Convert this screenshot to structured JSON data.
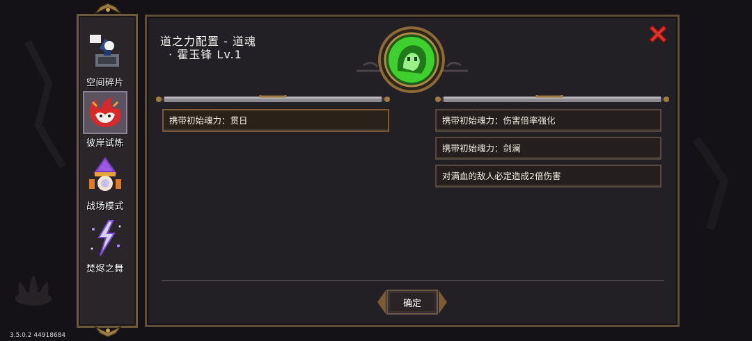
{
  "sidebar": {
    "items": [
      {
        "label": "空间碎片",
        "icon": "space-fragment-icon"
      },
      {
        "label": "彼岸试炼",
        "icon": "fox-spirit-icon",
        "active": true
      },
      {
        "label": "战场模式",
        "icon": "wizard-orb-icon"
      },
      {
        "label": "焚烬之舞",
        "icon": "lightning-rune-icon"
      }
    ]
  },
  "dialog": {
    "title": "道之力配置 - 道魂\n  · 霍玉锋 Lv.1",
    "emblem_icon": "green-soul-emblem-icon",
    "close_icon": "close-icon",
    "left_slots": [
      "携带初始魂力：贯日"
    ],
    "right_slots": [
      "携带初始魂力：伤害倍率强化",
      "携带初始魂力：剑澜",
      "对满血的敌人必定造成2倍伤害"
    ],
    "confirm_label": "确定"
  },
  "version": "3.5.0.2 44918684",
  "colors": {
    "panel_bg": "#221f25",
    "frame_gold": "#6b5a3c",
    "close_red": "#e0302a",
    "emblem_green": "#3fcf2e"
  }
}
